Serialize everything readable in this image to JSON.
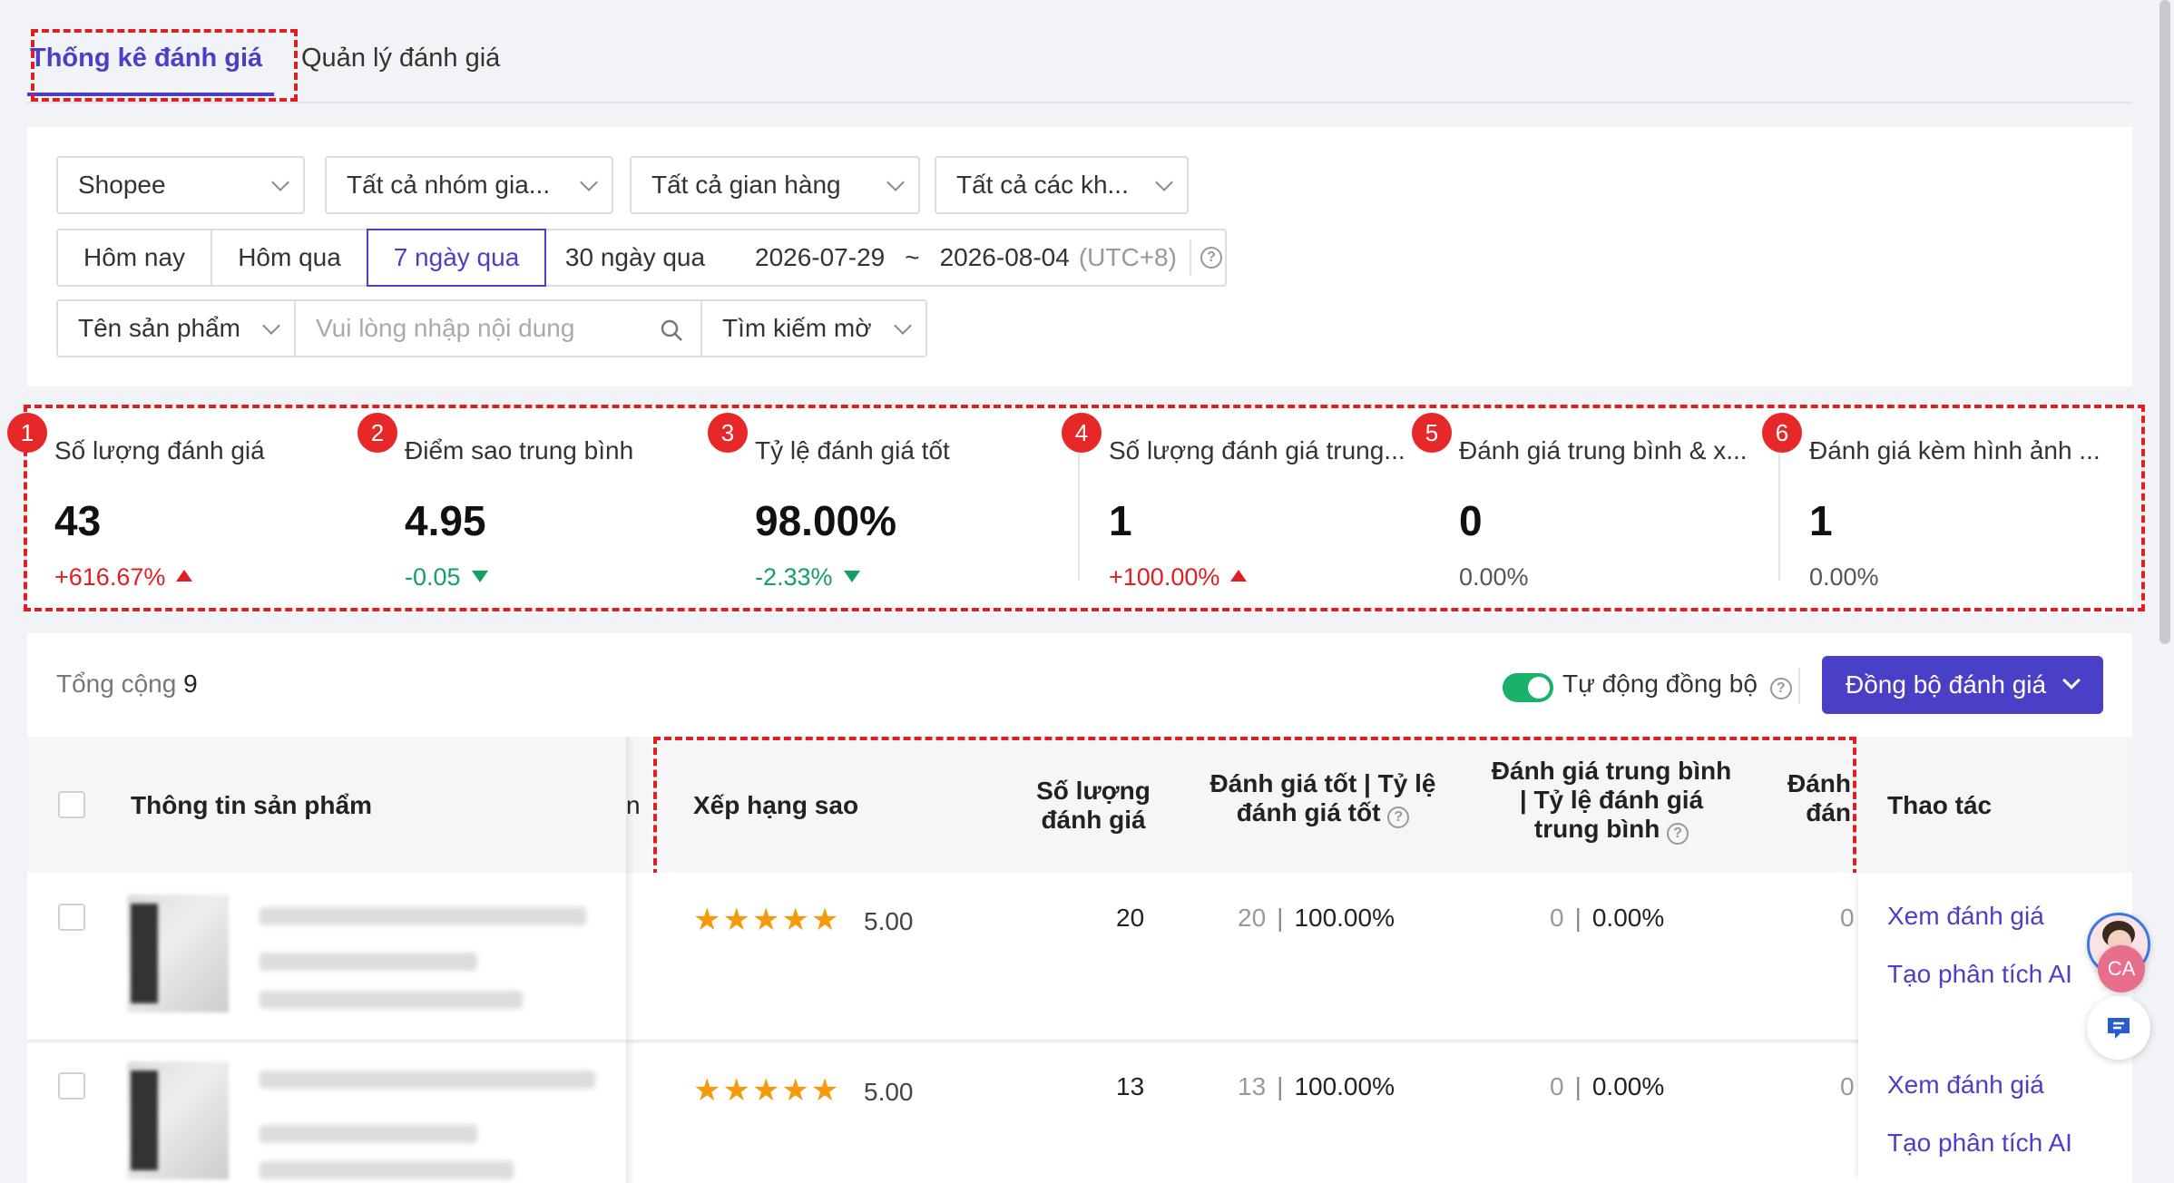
{
  "tabs": {
    "active": "Thống kê đánh giá",
    "inactive": "Quản lý đánh giá"
  },
  "filters": {
    "platform": "Shopee",
    "group": "Tất cả nhóm gia...",
    "shop": "Tất cả gian hàng",
    "customer": "Tất cả các kh...",
    "date_tabs": [
      "Hôm nay",
      "Hôm qua",
      "7 ngày qua",
      "30 ngày qua"
    ],
    "date_start": "2026-07-29",
    "date_sep": "~",
    "date_end": "2026-08-04",
    "timezone": "(UTC+8)",
    "search_field": "Tên sản phẩm",
    "search_placeholder": "Vui lòng nhập nội dung",
    "search_mode": "Tìm kiếm mờ"
  },
  "stats": [
    {
      "num": "1",
      "label": "Số lượng đánh giá",
      "value": "43",
      "change": "+616.67%",
      "trend": "up"
    },
    {
      "num": "2",
      "label": "Điểm sao trung bình",
      "value": "4.95",
      "change": "-0.05",
      "trend": "down"
    },
    {
      "num": "3",
      "label": "Tỷ lệ đánh giá tốt",
      "value": "98.00%",
      "change": "-2.33%",
      "trend": "down"
    },
    {
      "num": "4",
      "label": "Số lượng đánh giá trung...",
      "value": "1",
      "change": "+100.00%",
      "trend": "up"
    },
    {
      "num": "5",
      "label": "Đánh giá trung bình & x...",
      "value": "0",
      "change": "0.00%",
      "trend": "flat"
    },
    {
      "num": "6",
      "label": "Đánh giá kèm hình ảnh ...",
      "value": "1",
      "change": "0.00%",
      "trend": "flat"
    }
  ],
  "table": {
    "total_label": "Tổng cộng",
    "total_value": "9",
    "auto_sync_label": "Tự động đồng bộ",
    "sync_button": "Đồng bộ đánh giá",
    "headers": {
      "product": "Thông tin sản phẩm",
      "rating": "Xếp hạng sao",
      "count_l1": "Số lượng",
      "count_l2": "đánh giá",
      "good_l1": "Đánh giá tốt | Tỷ lệ",
      "good_l2": "đánh giá tốt",
      "avg_l1": "Đánh giá trung bình",
      "avg_l2": "| Tỷ lệ đánh giá",
      "avg_l3": "trung bình",
      "bad_l1": "Đánh",
      "bad_l2": "đán",
      "action": "Thao tác",
      "cut_letter": "n"
    },
    "rows": [
      {
        "stars": "★★★★★",
        "rating": "5.00",
        "count": "20",
        "good_count": "20",
        "good_rate": "100.00%",
        "avg_count": "0",
        "avg_rate": "0.00%",
        "bad": "0",
        "view": "Xem đánh giá",
        "ai": "Tạo phân tích AI"
      },
      {
        "stars": "★★★★★",
        "rating": "5.00",
        "count": "13",
        "good_count": "13",
        "good_rate": "100.00%",
        "avg_count": "0",
        "avg_rate": "0.00%",
        "bad": "0",
        "view": "Xem đánh giá",
        "ai": "Tạo phân tích AI"
      }
    ]
  },
  "float_widgets": {
    "avatar_text": "CA"
  },
  "colors": {
    "accent": "#4b3fc8",
    "up": "#e02020",
    "down": "#12a163",
    "star": "#f59a0e",
    "annotation": "#e02020"
  }
}
